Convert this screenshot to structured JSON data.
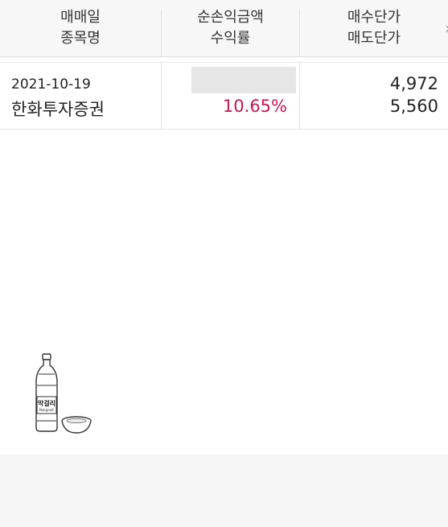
{
  "header": {
    "col1_line1": "매매일",
    "col1_line2": "종목명",
    "col2_line1": "순손익금액",
    "col2_line2": "수익률",
    "col3_line1": "매수단가",
    "col3_line2": "매도단가",
    "more_icon": "chevron-right-icon"
  },
  "rows": [
    {
      "date": "2021-10-19",
      "stock": "한화투자증권",
      "rate": "10.65%",
      "buy_price": "4,972",
      "sell_price": "5,560"
    }
  ],
  "illustration": {
    "label": "막걸리",
    "sublabel": "Makgeolli"
  },
  "colors": {
    "rate_positive": "#c8164f",
    "header_bg": "#f7f7f7",
    "footer_bg": "#f5f5f5"
  }
}
